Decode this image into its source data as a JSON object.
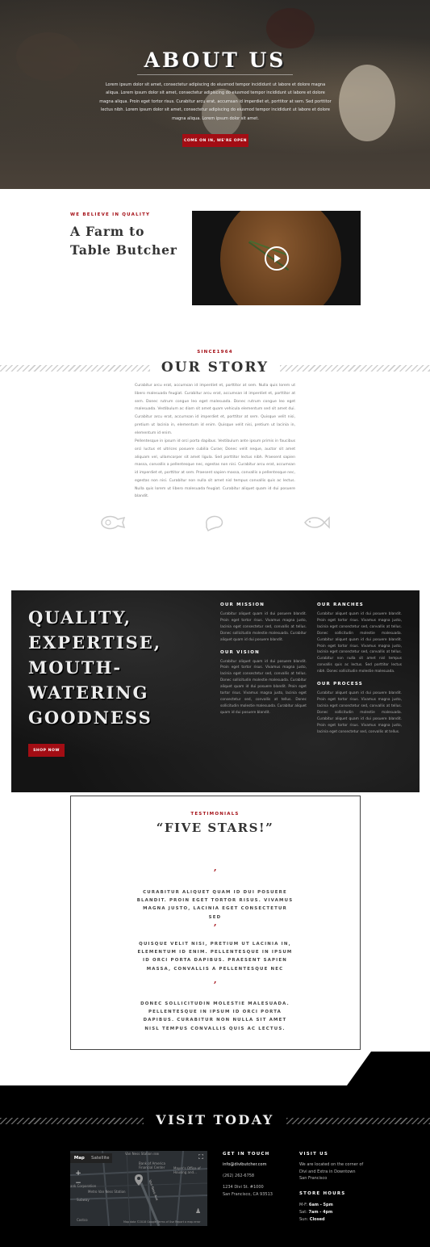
{
  "hero": {
    "title": "ABOUT US",
    "paragraph": "Lorem ipsum dolor sit amet, consectetur adipiscing do eiusmod tempor incididunt ut labore et dolore magna aliqua. Lorem ipsum dolor sit amet, consectetur adipiscing do eiusmod tempor incididunt ut labore et dolore magna aliqua. Proin eget tortor risus. Curabitur arcu erat, accumsan id imperdiet et, porttitor at sem. Sed porttitor lectus nibh. Lorem ipsum dolor sit amet, consectetur adipiscing do eiusmod tempor incididunt ut labore et dolore magna aliqua. Lorem ipsum dolor sit amet.",
    "button": "COME ON IN, WE'RE OPEN"
  },
  "farm": {
    "kicker": "WE BELIEVE IN QUALITY",
    "title": "A Farm to Table Butcher",
    "video_icon": "play-icon"
  },
  "story": {
    "kicker": "SINCE1964",
    "title": "OUR STORY",
    "p1": "Curabitur arcu erat, accumsan id imperdiet et, porttitor at sem. Nulla quis lorem ut libero malesuada feugiat. Curabitur arcu erat, accumsan id imperdiet et, porttitor at sem. Donec rutrum congue leo eget malesuada. Donec rutrum congue leo eget malesuada. Vestibulum ac diam sit amet quam vehicula elementum sed sit amet dui. Curabitur arcu erat, accumsan id imperdiet et, porttitor at sem. Quisque velit nisi, pretium ut lacinia in, elementum id enim. Quisque velit nisi, pretium ut lacinia in, elementum id enim.",
    "p2": "Pellentesque in ipsum id orci porta dapibus. Vestibulum ante ipsum primis in faucibus orci luctus et ultrices posuere cubilia Curae; Donec velit neque, auctor sit amet aliquam vel, ullamcorper sit amet ligula. Sed porttitor lectus nibh. Praesent sapien massa, convallis a pellentesque nec, egestas non nisi. Curabitur arcu erat, accumsan id imperdiet et, porttitor at sem. Praesent sapien massa, convallis a pellentesque nec, egestas non nisi. Curabitur non nulla sit amet nisl tempus convallis quis ac lectus. Nulla quis lorem ut libero malesuada feugiat. Curabitur aliquet quam id dui posuere blandit.",
    "icons": [
      "ham-icon",
      "chicken-drumstick-icon",
      "fish-icon"
    ]
  },
  "quality": {
    "heading": "QUALITY, EXPERTISE, MOUTH-WATERING GOODNESS",
    "button": "SHOP NOW",
    "mission_title": "OUR MISSION",
    "mission_text": "Curabitur aliquet quam id dui posuere blandit. Proin eget tortor risus. Vivamus magna justo, lacinia eget consectetur sed, convallis at tellus. Donec sollicitudin molestie malesuada. Curabitur aliquet quam id dui posuere blandit.",
    "vision_title": "OUR VISION",
    "vision_text": "Curabitur aliquet quam id dui posuere blandit. Proin eget tortor risus. Vivamus magna justo, lacinia eget consectetur sed, convallis at tellus. Donec sollicitudin molestie malesuada. Curabitur aliquet quam id dui posuere blandit. Proin eget tortor risus. Vivamus magna justo, lacinia eget consectetur sed, convallis at tellus. Donec sollicitudin molestie malesuada. Curabitur aliquet quam id dui posuere blandit.",
    "ranches_title": "OUR RANCHES",
    "ranches_text": "Curabitur aliquet quam id dui posuere blandit. Proin eget tortor risus. Vivamus magna justo, lacinia eget consectetur sed, convallis at tellus. Donec sollicitudin molestie malesuada. Curabitur aliquet quam id dui posuere blandit. Proin eget tortor risus. Vivamus magna justo, lacinia eget consectetur sed, convallis at tellus. Curabitur non nulla sit amet nisl tempus convallis quis ac lectus. Sed porttitor lectus nibh. Donec sollicitudin molestie malesuada.",
    "process_title": "OUR PROCESS",
    "process_text": "Curabitur aliquet quam id dui posuere blandit. Proin eget tortor risus. Vivamus magna justo, lacinia eget consectetur sed, convallis at tellus. Donec sollicitudin molestie malesuada. Curabitur aliquet quam id dui posuere blandit. Proin eget tortor risus. Vivamus magna justo, lacinia eget consectetur sed, convallis at tellus."
  },
  "testimonials": {
    "kicker": "TESTIMONIALS",
    "title": "“FIVE STARS!”",
    "mark": "’",
    "quotes": [
      "CURABITUR ALIQUET QUAM ID DUI POSUERE BLANDIT. PROIN EGET TORTOR RISUS. VIVAMUS MAGNA JUSTO, LACINIA EGET CONSECTETUR SED",
      "QUISQUE VELIT NISI, PRETIUM UT LACINIA IN, ELEMENTUM ID ENIM. PELLENTESQUE IN IPSUM ID ORCI PORTA DAPIBUS. PRAESENT SAPIEN MASSA, CONVALLIS A PELLENTESQUE NEC",
      "DONEC SOLLICITUDIN MOLESTIE MALESUADA. PELLENTESQUE IN IPSUM ID ORCI PORTA DAPIBUS. CURABITUR NON NULLA SIT AMET NISL TEMPUS CONVALLIS QUIS AC LECTUS."
    ]
  },
  "visit": {
    "title": "VISIT TODAY",
    "map": {
      "tab_map": "Map",
      "tab_satellite": "Satellite",
      "labels": [
        "Van Ness Station ⊟⊞",
        "Bank of America Financial Center",
        "Mayor's Office of Housing and...",
        "Metro Van Ness Station",
        "Van Ness Ave",
        "Subway",
        "ank Corporation",
        "Costco"
      ],
      "attribution": "Map data ©2018 Google   Terms of Use   Report a map error"
    },
    "contact_title": "GET IN TOUCH",
    "email": "info@divibutcher.com",
    "phone": "(262) 262-6758",
    "address1": "1234 Divi St. #1000",
    "address2": "San Francisco, CA 93513",
    "visit_title": "VISIT US",
    "visit_text": "We are located on the corner of Divi and Extra in Downtown San Francisco",
    "hours_title": "STORE HOURS",
    "hours": [
      {
        "day": "M-F:",
        "time": "6am - 5pm"
      },
      {
        "day": "Sat:",
        "time": "7am - 4pm"
      },
      {
        "day": "Sun:",
        "time": "Closed"
      }
    ]
  }
}
